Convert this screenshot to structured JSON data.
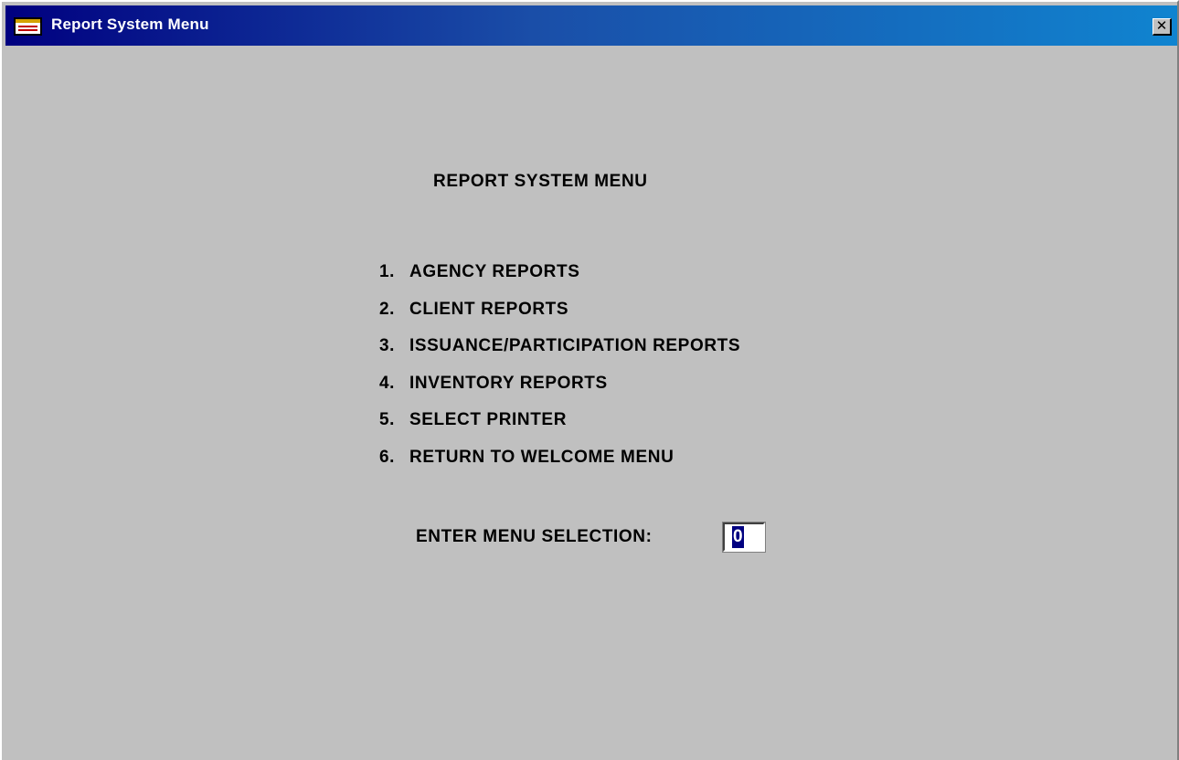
{
  "window": {
    "title": "Report System Menu",
    "close_symbol": "✕"
  },
  "main": {
    "heading": "REPORT SYSTEM MENU",
    "menu_items": [
      {
        "number": "1.",
        "label": "AGENCY REPORTS"
      },
      {
        "number": "2.",
        "label": "CLIENT REPORTS"
      },
      {
        "number": "3.",
        "label": "ISSUANCE/PARTICIPATION REPORTS"
      },
      {
        "number": "4.",
        "label": "INVENTORY REPORTS"
      },
      {
        "number": "5.",
        "label": "SELECT PRINTER"
      },
      {
        "number": "6.",
        "label": "RETURN TO WELCOME MENU"
      }
    ],
    "prompt_label": "ENTER MENU SELECTION:",
    "selection_value": "0"
  },
  "colors": {
    "titlebar_start": "#000080",
    "titlebar_end": "#1084d0",
    "background": "#c0c0c0",
    "selection_highlight": "#000080"
  },
  "icons": {
    "window_icon": "form-icon",
    "close": "close-icon"
  }
}
